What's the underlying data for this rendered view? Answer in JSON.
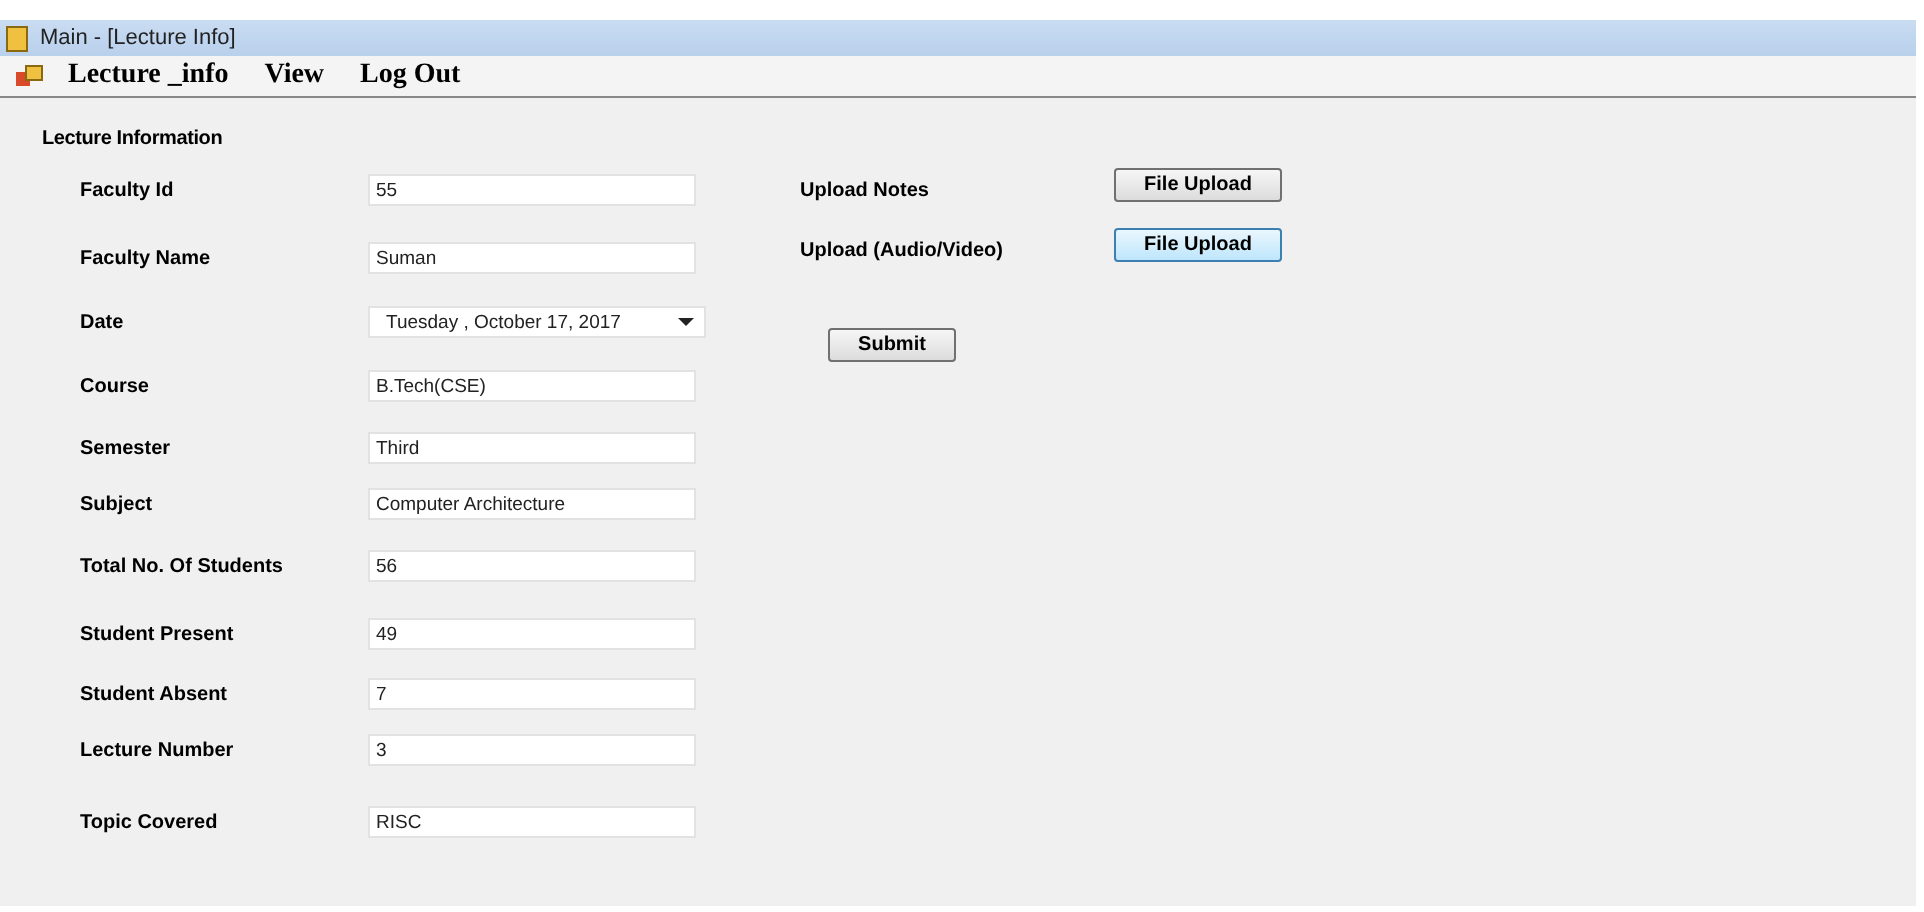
{
  "window": {
    "title": "Main - [Lecture Info]"
  },
  "menu": [
    "Lecture _info",
    "View",
    "Log Out"
  ],
  "section_title": "Lecture Information",
  "fields": [
    {
      "label": "Faculty Id",
      "value": "55",
      "kind": "text"
    },
    {
      "label": "Faculty Name",
      "value": "Suman",
      "kind": "text"
    },
    {
      "label": "Date",
      "value": "Tuesday  ,  October  17, 2017",
      "kind": "date"
    },
    {
      "label": "Course",
      "value": "B.Tech(CSE)",
      "kind": "text"
    },
    {
      "label": "Semester",
      "value": "Third",
      "kind": "text"
    },
    {
      "label": "Subject",
      "value": "Computer Architecture",
      "kind": "text"
    },
    {
      "label": "Total No. Of Students",
      "value": "56",
      "kind": "text"
    },
    {
      "label": "Student Present",
      "value": "49",
      "kind": "text"
    },
    {
      "label": "Student Absent",
      "value": "7",
      "kind": "text"
    },
    {
      "label": "Lecture Number",
      "value": "3",
      "kind": "text"
    },
    {
      "label": "Topic Covered",
      "value": "RISC",
      "kind": "text"
    }
  ],
  "uploads": [
    {
      "label": "Upload Notes",
      "button": "File Upload",
      "focused": false
    },
    {
      "label": "Upload (Audio/Video)",
      "button": "File Upload",
      "focused": true
    }
  ],
  "submit": "Submit"
}
